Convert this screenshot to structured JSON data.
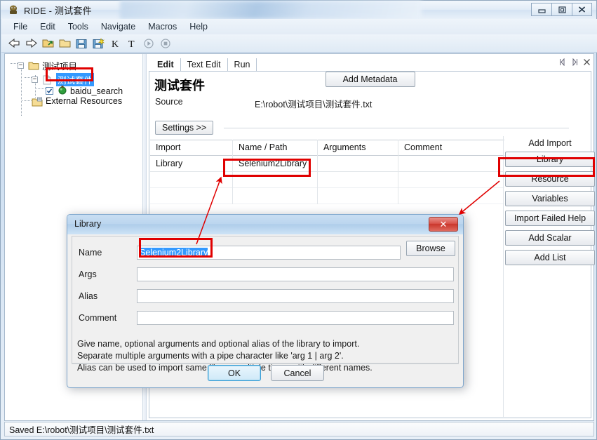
{
  "window": {
    "title": "RIDE - 测试套件",
    "app_icon": "robot-icon",
    "buttons": {
      "minimize": "minimize-icon",
      "maximize": "maximize-icon",
      "close": "close-icon"
    }
  },
  "menubar": {
    "items": [
      "File",
      "Edit",
      "Tools",
      "Navigate",
      "Macros",
      "Help"
    ]
  },
  "toolbar": {
    "items": [
      "back-arrow-icon",
      "forward-arrow-icon",
      "open-file-icon",
      "open-folder-icon",
      "save-icon",
      "save-all-icon",
      "keyword-k-icon",
      "test-t-icon",
      "run-play-icon",
      "stop-icon"
    ]
  },
  "tree": {
    "nodes": [
      {
        "label": "测试项目",
        "icon": "folder-icon",
        "expander": "-",
        "selected": false,
        "checkbox": null
      },
      {
        "label": "测试套件",
        "icon": "file-icon",
        "expander": "-",
        "selected": true,
        "checkbox": null
      },
      {
        "label": "baidu_search",
        "icon": "testcase-icon",
        "expander": null,
        "selected": false,
        "checkbox": "checked"
      },
      {
        "label": "External Resources",
        "icon": "resources-folder-icon",
        "expander": null,
        "selected": false,
        "checkbox": null
      }
    ]
  },
  "editor": {
    "tabs": [
      {
        "label": "Edit",
        "active": true
      },
      {
        "label": "Text Edit",
        "active": false
      },
      {
        "label": "Run",
        "active": false
      }
    ],
    "tab_nav": [
      "prev-tab-icon",
      "next-tab-icon",
      "close-tab-icon"
    ],
    "suite_title": "测试套件",
    "source_label": "Source",
    "source_value": "E:\\robot\\测试项目\\测试套件.txt",
    "settings_button": "Settings >>",
    "grid": {
      "headers": [
        "Import",
        "Name / Path",
        "Arguments",
        "Comment"
      ],
      "rows": [
        [
          "Library",
          "Selenium2Library",
          "",
          ""
        ],
        [
          "",
          "",
          "",
          ""
        ],
        [
          "",
          "",
          "",
          ""
        ]
      ]
    },
    "side_panel": {
      "title": "Add Import",
      "buttons": [
        "Library",
        "Resource",
        "Variables",
        "Import Failed Help",
        "Add Scalar",
        "Add List"
      ],
      "metadata_button": "Add Metadata"
    }
  },
  "dialog": {
    "title": "Library",
    "close_label": "✕",
    "fields": [
      {
        "label": "Name",
        "value": "Selenium2Library",
        "selected": true
      },
      {
        "label": "Args",
        "value": "",
        "selected": false
      },
      {
        "label": "Alias",
        "value": "",
        "selected": false
      },
      {
        "label": "Comment",
        "value": "",
        "selected": false
      }
    ],
    "browse_button": "Browse",
    "help_lines": [
      "Give name, optional arguments and optional alias of the library to import.",
      "Separate multiple arguments with a pipe character like 'arg 1 | arg 2'.",
      "Alias can be used to import same library multiple times with different names."
    ],
    "ok_button": "OK",
    "cancel_button": "Cancel"
  },
  "statusbar": {
    "text": "Saved E:\\robot\\测试项目\\测试套件.txt"
  },
  "annotations": {
    "color": "#e00000",
    "boxes": [
      "tree-selected-node",
      "grid-library-name-cell",
      "side-panel-library-button",
      "dialog-name-input"
    ],
    "arrows": [
      "name-input-to-grid-cell",
      "library-button-to-dialog"
    ]
  }
}
